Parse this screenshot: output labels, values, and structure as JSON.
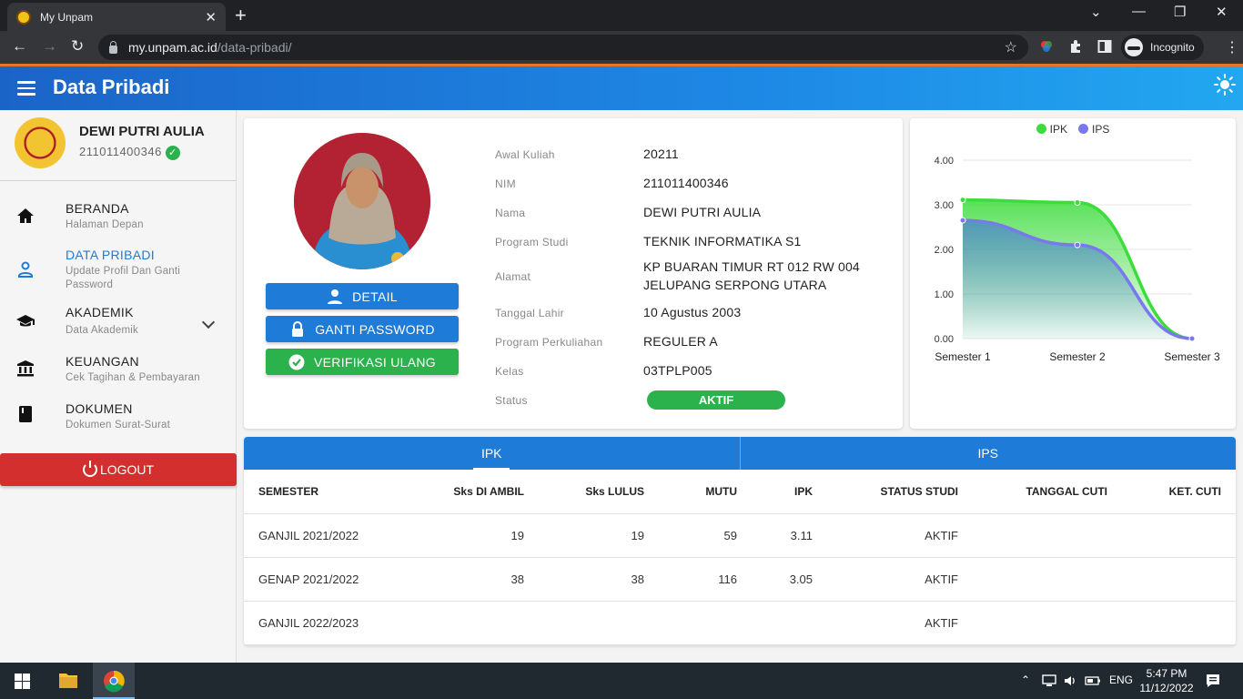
{
  "browser": {
    "tab_title": "My Unpam",
    "url_host": "my.unpam.ac.id",
    "url_path": "/data-pribadi/",
    "profile_label": "Incognito"
  },
  "header": {
    "title": "Data Pribadi"
  },
  "profile": {
    "name": "DEWI PUTRI AULIA",
    "nim": "211011400346"
  },
  "sidebar": {
    "items": [
      {
        "label": "BERANDA",
        "sub": "Halaman Depan"
      },
      {
        "label": "DATA PRIBADI",
        "sub": "Update Profil Dan Ganti Password"
      },
      {
        "label": "AKADEMIK",
        "sub": "Data Akademik"
      },
      {
        "label": "KEUANGAN",
        "sub": "Cek Tagihan & Pembayaran"
      },
      {
        "label": "DOKUMEN",
        "sub": "Dokumen Surat-Surat"
      }
    ],
    "logout_label": "LOGOUT"
  },
  "actions": {
    "detail": "DETAIL",
    "password": "GANTI PASSWORD",
    "verify": "VERIFIKASI ULANG"
  },
  "info": {
    "awal_kuliah": {
      "label": "Awal Kuliah",
      "value": "20211"
    },
    "nim": {
      "label": "NIM",
      "value": "211011400346"
    },
    "nama": {
      "label": "Nama",
      "value": "DEWI PUTRI AULIA"
    },
    "prodi": {
      "label": "Program Studi",
      "value": "TEKNIK INFORMATIKA S1"
    },
    "alamat": {
      "label": "Alamat",
      "value": "KP BUARAN TIMUR RT 012 RW 004 JELUPANG SERPONG UTARA"
    },
    "lahir": {
      "label": "Tanggal Lahir",
      "value": "10 Agustus 2003"
    },
    "perkuliahan": {
      "label": "Program Perkuliahan",
      "value": "REGULER A"
    },
    "kelas": {
      "label": "Kelas",
      "value": "03TPLP005"
    },
    "status": {
      "label": "Status",
      "value": "AKTIF"
    }
  },
  "chart_data": {
    "type": "area",
    "categories": [
      "Semester 1",
      "Semester 2",
      "Semester 3"
    ],
    "series": [
      {
        "name": "IPK",
        "values": [
          3.11,
          3.05,
          0
        ],
        "color": "#3ddc3d"
      },
      {
        "name": "IPS",
        "values": [
          2.65,
          2.1,
          0
        ],
        "color": "#7a78ee"
      }
    ],
    "ylim": [
      0,
      4
    ],
    "yticks": [
      "0.00",
      "1.00",
      "2.00",
      "3.00",
      "4.00"
    ],
    "legend": "top-center",
    "grid": true
  },
  "table": {
    "tabs": [
      "IPK",
      "IPS"
    ],
    "headers": [
      "SEMESTER",
      "Sks DI AMBIL",
      "Sks LULUS",
      "MUTU",
      "IPK",
      "STATUS STUDI",
      "TANGGAL CUTI",
      "KET. CUTI"
    ],
    "rows": [
      [
        "GANJIL 2021/2022",
        "19",
        "19",
        "59",
        "3.11",
        "AKTIF",
        "",
        ""
      ],
      [
        "GENAP 2021/2022",
        "38",
        "38",
        "116",
        "3.05",
        "AKTIF",
        "",
        ""
      ],
      [
        "GANJIL 2022/2023",
        "",
        "",
        "",
        "",
        "AKTIF",
        "",
        ""
      ]
    ]
  },
  "taskbar": {
    "lang": "ENG",
    "time": "5:47 PM",
    "date": "11/12/2022"
  }
}
